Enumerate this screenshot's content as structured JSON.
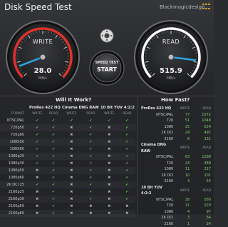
{
  "header": {
    "title": "Disk Speed Test",
    "brand": "Blackmagicdesign"
  },
  "write_gauge": {
    "label": "WRITE",
    "value": "28.0",
    "unit": "MB/s",
    "fraction": 0.09
  },
  "read_gauge": {
    "label": "READ",
    "value": "515.9",
    "unit": "MB/s",
    "fraction": 0.86
  },
  "start_button": {
    "line1": "SPEED TEST",
    "line2": "START"
  },
  "will_it_work": {
    "title": "Will It Work?",
    "groups": [
      "ProRes 422 HQ",
      "Cinema DNG RAW",
      "10 Bit YUV 4:2:2"
    ],
    "format_header": "FORMAT",
    "sub_headers": [
      "WRITE",
      "READ"
    ],
    "rows": [
      {
        "format": "NTSC/PAL",
        "marks": [
          1,
          1,
          1,
          1,
          1,
          1
        ]
      },
      {
        "format": "720p50",
        "marks": [
          1,
          1,
          0,
          1,
          0,
          1
        ]
      },
      {
        "format": "720p60",
        "marks": [
          1,
          1,
          0,
          1,
          0,
          1
        ]
      },
      {
        "format": "1080i50",
        "marks": [
          1,
          1,
          0,
          1,
          0,
          1
        ]
      },
      {
        "format": "1080i60",
        "marks": [
          1,
          1,
          0,
          1,
          0,
          1
        ]
      },
      {
        "format": "1080p25",
        "marks": [
          1,
          1,
          0,
          1,
          0,
          1
        ]
      },
      {
        "format": "1080p30",
        "marks": [
          1,
          1,
          0,
          1,
          0,
          1
        ]
      },
      {
        "format": "1080p50",
        "marks": [
          0,
          1,
          0,
          1,
          0,
          1
        ]
      },
      {
        "format": "1080p60",
        "marks": [
          0,
          1,
          0,
          1,
          0,
          1
        ]
      },
      {
        "format": "2K DCI 25",
        "marks": [
          1,
          1,
          0,
          1,
          0,
          1
        ]
      },
      {
        "format": "2160p25",
        "marks": [
          0,
          1,
          0,
          1,
          0,
          1
        ]
      },
      {
        "format": "2160p30",
        "marks": [
          0,
          1,
          0,
          1,
          0,
          1
        ]
      },
      {
        "format": "2160p50",
        "marks": [
          0,
          1,
          0,
          0,
          0,
          0
        ]
      },
      {
        "format": "2160p60",
        "marks": [
          0,
          1,
          0,
          0,
          0,
          0
        ]
      }
    ]
  },
  "how_fast": {
    "title": "How Fast?",
    "sub_headers": [
      "WRITE",
      "READ"
    ],
    "sections": [
      {
        "name": "ProRes 422 HQ",
        "rows": [
          {
            "format": "NTSC/PAL",
            "write": "77",
            "read": "1572"
          },
          {
            "format": "720",
            "write": "51",
            "read": "1048"
          },
          {
            "format": "1080",
            "write": "25",
            "read": "524"
          },
          {
            "format": "2K DCI",
            "write": "24",
            "read": "491"
          },
          {
            "format": "2160",
            "write": "6",
            "read": "131"
          }
        ]
      },
      {
        "name": "Cinema DNG RAW",
        "rows": [
          {
            "format": "NTSC/PAL",
            "write": "63",
            "read": "1288"
          },
          {
            "format": "720",
            "write": "24",
            "read": "489"
          },
          {
            "format": "1080",
            "write": "11",
            "read": "217"
          },
          {
            "format": "2K DCI",
            "write": "10",
            "read": "201"
          },
          {
            "format": "2160",
            "write": "3",
            "read": "54"
          }
        ]
      },
      {
        "name": "10 Bit YUV 4:2:2",
        "rows": [
          {
            "format": "NTSC/PAL",
            "write": "28",
            "read": "580"
          },
          {
            "format": "720",
            "write": "11",
            "read": "220"
          },
          {
            "format": "1080",
            "write": "4",
            "read": "97"
          },
          {
            "format": "2K DCI",
            "write": "3",
            "read": "64"
          },
          {
            "format": "2160",
            "write": "1",
            "read": "24"
          }
        ]
      }
    ]
  },
  "colors": {
    "write_accent": "#e0322c",
    "read_accent": "#ffffff",
    "needle": "#2aa6e8",
    "check": "#5fcf4c"
  }
}
